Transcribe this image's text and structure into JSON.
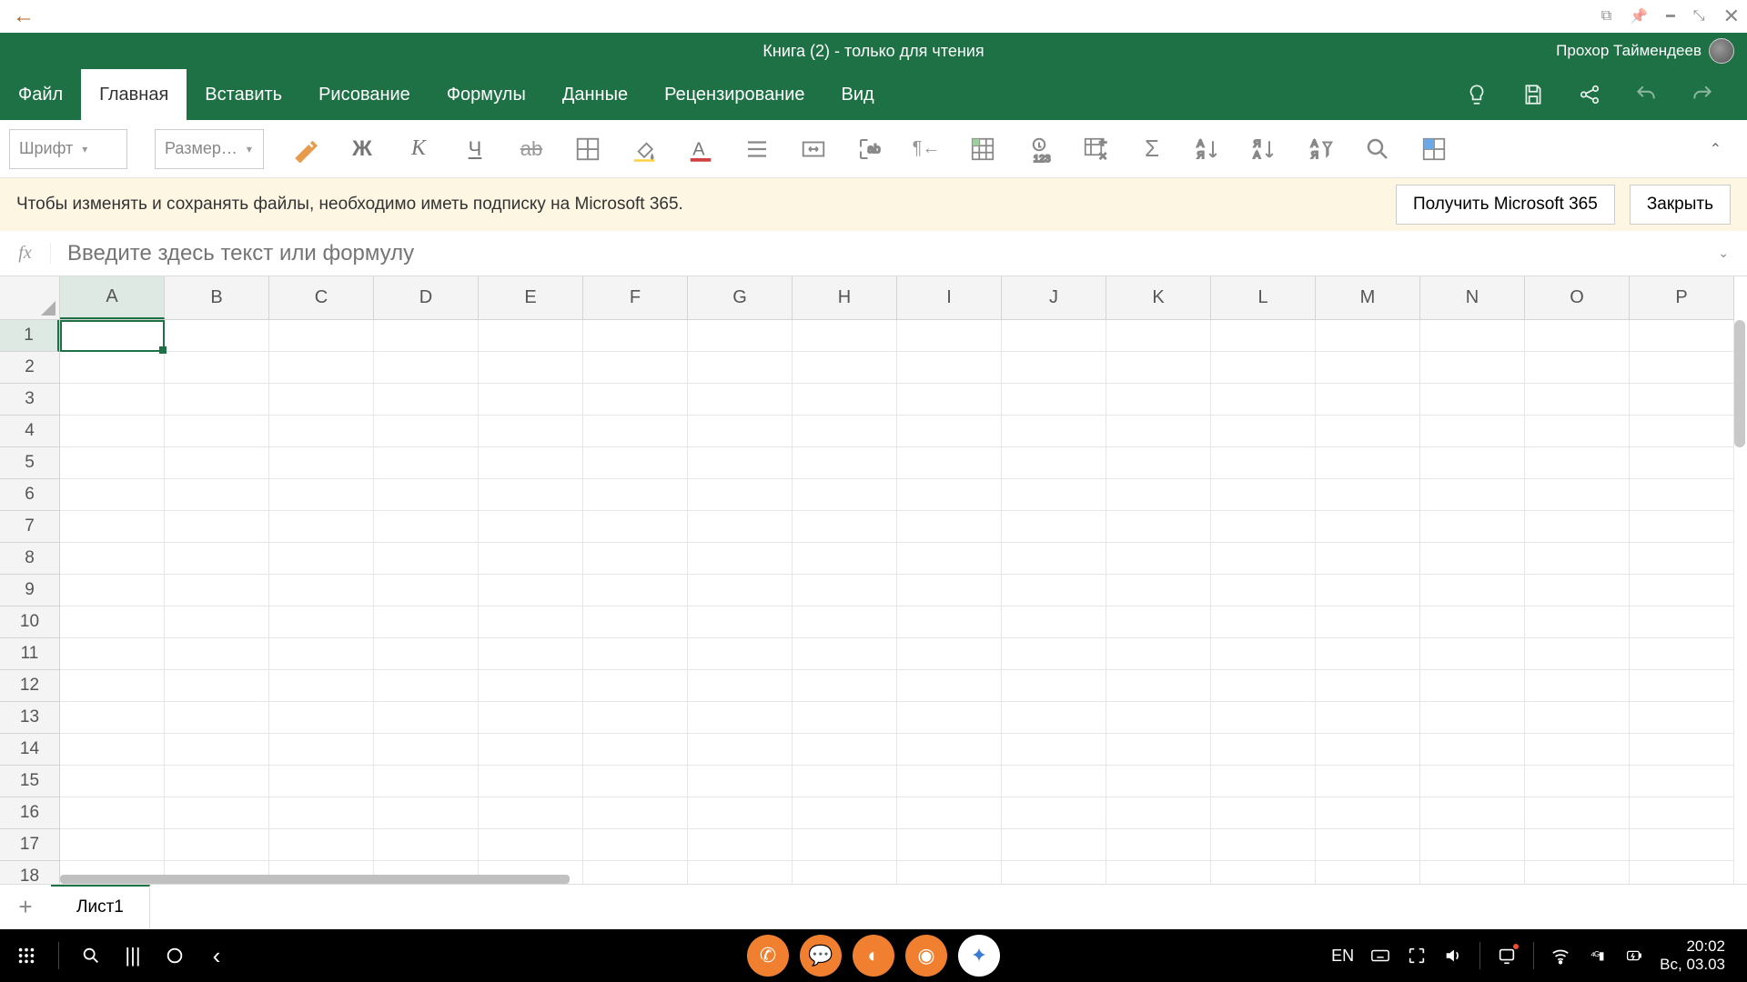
{
  "title": "Книга (2) - только для чтения",
  "user": {
    "name": "Прохор Таймендеев"
  },
  "tabs": [
    "Файл",
    "Главная",
    "Вставить",
    "Рисование",
    "Формулы",
    "Данные",
    "Рецензирование",
    "Вид"
  ],
  "active_tab_index": 1,
  "toolbar": {
    "font_placeholder": "Шрифт",
    "size_placeholder": "Размер…"
  },
  "banner": {
    "text": "Чтобы изменять и сохранять файлы, необходимо иметь подписку на Microsoft 365.",
    "cta": "Получить Microsoft 365",
    "close": "Закрыть"
  },
  "formula": {
    "fx": "fx",
    "placeholder": "Введите здесь текст или формулу"
  },
  "columns": [
    "A",
    "B",
    "C",
    "D",
    "E",
    "F",
    "G",
    "H",
    "I",
    "J",
    "K",
    "L",
    "M",
    "N",
    "O",
    "P"
  ],
  "rows": [
    1,
    2,
    3,
    4,
    5,
    6,
    7,
    8,
    9,
    10,
    11,
    12,
    13,
    14,
    15,
    16,
    17,
    18
  ],
  "selected_cell": {
    "col": 0,
    "row": 0
  },
  "sheet": {
    "name": "Лист1"
  },
  "taskbar": {
    "lang": "EN",
    "time": "20:02",
    "date": "Вс, 03.03"
  }
}
